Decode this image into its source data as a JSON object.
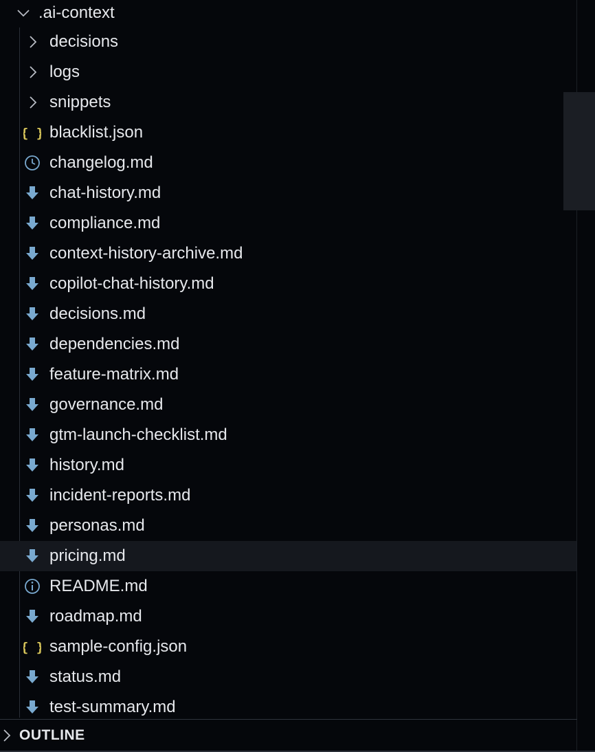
{
  "explorer": {
    "folder": {
      "name": ".ai-context",
      "expanded": true
    },
    "items": [
      {
        "type": "folder",
        "name": "decisions",
        "icon": "chevron-right-icon"
      },
      {
        "type": "folder",
        "name": "logs",
        "icon": "chevron-right-icon"
      },
      {
        "type": "folder",
        "name": "snippets",
        "icon": "chevron-right-icon"
      },
      {
        "type": "file",
        "name": "blacklist.json",
        "icon": "json-icon"
      },
      {
        "type": "file",
        "name": "changelog.md",
        "icon": "clock-icon"
      },
      {
        "type": "file",
        "name": "chat-history.md",
        "icon": "markdown-arrow-icon"
      },
      {
        "type": "file",
        "name": "compliance.md",
        "icon": "markdown-arrow-icon"
      },
      {
        "type": "file",
        "name": "context-history-archive.md",
        "icon": "markdown-arrow-icon"
      },
      {
        "type": "file",
        "name": "copilot-chat-history.md",
        "icon": "markdown-arrow-icon"
      },
      {
        "type": "file",
        "name": "decisions.md",
        "icon": "markdown-arrow-icon"
      },
      {
        "type": "file",
        "name": "dependencies.md",
        "icon": "markdown-arrow-icon"
      },
      {
        "type": "file",
        "name": "feature-matrix.md",
        "icon": "markdown-arrow-icon"
      },
      {
        "type": "file",
        "name": "governance.md",
        "icon": "markdown-arrow-icon"
      },
      {
        "type": "file",
        "name": "gtm-launch-checklist.md",
        "icon": "markdown-arrow-icon"
      },
      {
        "type": "file",
        "name": "history.md",
        "icon": "markdown-arrow-icon"
      },
      {
        "type": "file",
        "name": "incident-reports.md",
        "icon": "markdown-arrow-icon"
      },
      {
        "type": "file",
        "name": "personas.md",
        "icon": "markdown-arrow-icon"
      },
      {
        "type": "file",
        "name": "pricing.md",
        "icon": "markdown-arrow-icon",
        "selected": true
      },
      {
        "type": "file",
        "name": "README.md",
        "icon": "info-icon"
      },
      {
        "type": "file",
        "name": "roadmap.md",
        "icon": "markdown-arrow-icon"
      },
      {
        "type": "file",
        "name": "sample-config.json",
        "icon": "json-icon"
      },
      {
        "type": "file",
        "name": "status.md",
        "icon": "markdown-arrow-icon"
      },
      {
        "type": "file",
        "name": "test-summary.md",
        "icon": "markdown-arrow-icon"
      }
    ]
  },
  "outline": {
    "label": "OUTLINE",
    "expanded": false
  },
  "colors": {
    "background": "#05070b",
    "text": "#e6e8ec",
    "chevron": "#b8bcc4",
    "json_icon": "#d7c55a",
    "markdown_icon": "#79a9cf",
    "info_icon": "#79a9cf",
    "selected_row": "#15181e"
  }
}
